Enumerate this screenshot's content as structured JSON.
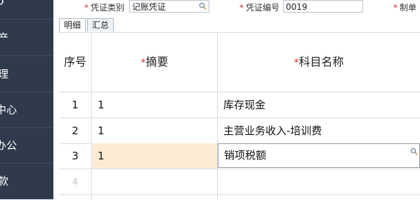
{
  "sidebar": {
    "items": [
      {
        "label": "D"
      },
      {
        "label": "资产"
      },
      {
        "label": "管理"
      },
      {
        "label": "中心"
      },
      {
        "label": "办公"
      },
      {
        "label": "借款"
      }
    ]
  },
  "form": {
    "voucher_type_label": "凭证类别",
    "voucher_type_value": "记账凭证",
    "voucher_no_label": "凭证编号",
    "voucher_no_value": "0019",
    "maker_label": "制单"
  },
  "tabs": [
    {
      "label": "明细",
      "active": true
    },
    {
      "label": "汇总",
      "active": false
    }
  ],
  "grid": {
    "headers": {
      "index": "序号",
      "summary": "摘要",
      "account": "科目名称"
    },
    "required_mark": "*",
    "rows": [
      {
        "index": "1",
        "summary": "1",
        "account": "库存现金"
      },
      {
        "index": "2",
        "summary": "1",
        "account": "主营业务收入-培训费"
      },
      {
        "index": "3",
        "summary": "1",
        "account": "销项税额"
      },
      {
        "index": "4",
        "summary": "",
        "account": ""
      }
    ]
  },
  "colors": {
    "sidebar_bg": "#2f3b4c",
    "required": "#d0302c",
    "active_cell": "#fdebd3"
  },
  "icons": {
    "lookup": "magnifier-icon"
  }
}
